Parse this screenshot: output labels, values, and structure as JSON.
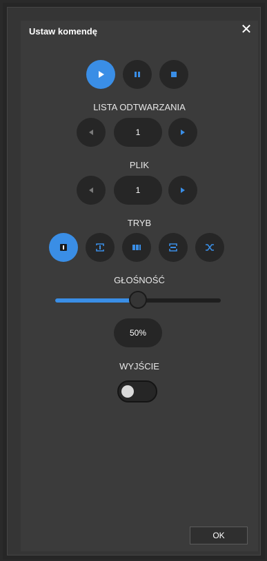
{
  "dialog": {
    "title": "Ustaw komendę",
    "close_glyph": "✕"
  },
  "transport": {
    "buttons": [
      {
        "name": "play",
        "icon": "play-icon",
        "active": true
      },
      {
        "name": "pause",
        "icon": "pause-icon",
        "active": false
      },
      {
        "name": "stop",
        "icon": "stop-icon",
        "active": false
      }
    ]
  },
  "playlist": {
    "label": "LISTA ODTWARZANIA",
    "value": "1"
  },
  "file": {
    "label": "PLIK",
    "value": "1"
  },
  "mode": {
    "label": "TRYB",
    "options": [
      {
        "icon": "play-once-icon",
        "active": true
      },
      {
        "icon": "repeat-one-icon",
        "active": false
      },
      {
        "icon": "play-all-icon",
        "active": false
      },
      {
        "icon": "repeat-all-icon",
        "active": false
      },
      {
        "icon": "shuffle-icon",
        "active": false
      }
    ]
  },
  "volume": {
    "label": "GŁOŚNOŚĆ",
    "percent": 50,
    "display": "50%"
  },
  "output": {
    "label": "WYJŚCIE",
    "enabled": false
  },
  "footer": {
    "ok_label": "OK"
  },
  "colors": {
    "accent": "#3a8ee6",
    "button_bg": "#262626",
    "dialog_bg": "#3b3b3b"
  }
}
